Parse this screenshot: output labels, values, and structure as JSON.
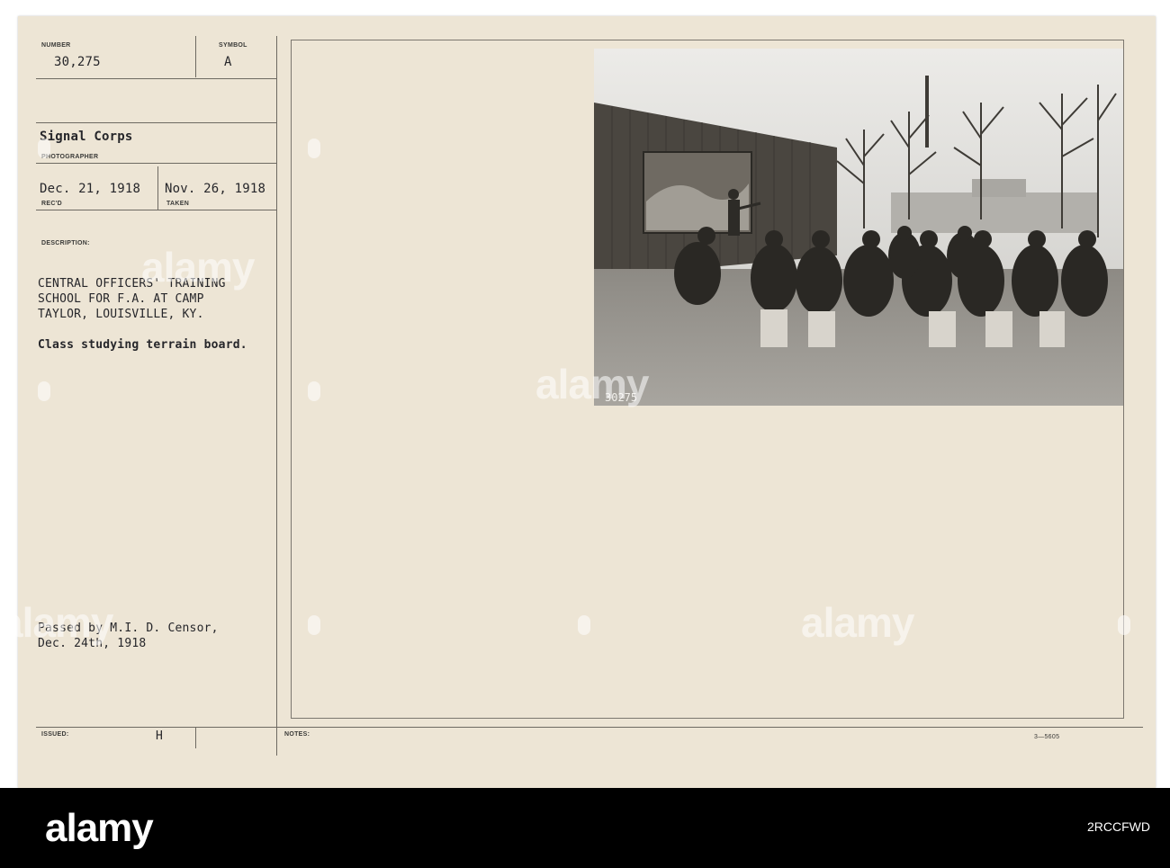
{
  "card": {
    "number_label": "NUMBER",
    "number_value": "30,275",
    "symbol_label": "SYMBOL",
    "symbol_value": "A",
    "photographer_value": "Signal Corps",
    "photographer_label": "PHOTOGRAPHER",
    "received_value": "Dec. 21, 1918",
    "received_label": "REC'D",
    "taken_value": "Nov. 26, 1918",
    "taken_label": "TAKEN",
    "description_label": "DESCRIPTION:",
    "description_lines": [
      "CENTRAL OFFICERS' TRAINING",
      "SCHOOL FOR F.A. AT CAMP",
      "TAYLOR, LOUISVILLE, KY."
    ],
    "caption": "Class studying terrain board.",
    "censor_lines": [
      "Passed by M.I. D. Censor,",
      "Dec. 24th, 1918"
    ],
    "issued_label": "ISSUED:",
    "issued_value": "H",
    "notes_label": "NOTES:",
    "form_code": "3—5605"
  },
  "photo": {
    "negative_number": "30275"
  },
  "watermark": {
    "text": "alamy"
  },
  "footer": {
    "logo": "alamy",
    "image_id": "2RCCFWD"
  },
  "colors": {
    "card": "#ede5d5",
    "ink": "#26262a",
    "footer": "#000000"
  }
}
